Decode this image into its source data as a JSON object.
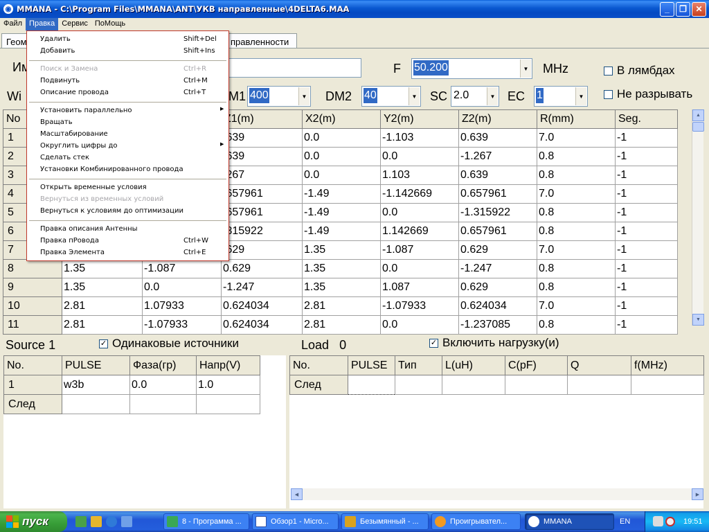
{
  "window": {
    "title": "MMANA - C:\\Program Files\\MMANA\\ANT\\УКВ направленные\\4DELTA6.MAA",
    "minimize": "_",
    "maximize": "❐",
    "close": "✕"
  },
  "menubar": [
    "Файл",
    "Правка",
    "Сервис",
    "ПоМощь"
  ],
  "tabs": [
    "Геом",
    "правленности"
  ],
  "params": {
    "name_label": "Им",
    "name_value": "",
    "f_label": "F",
    "f_value": "50.200",
    "mhz_label": "MHz",
    "lambda_label": "В лямбдах",
    "nobreak_label": "Не разрывать",
    "wire_label": "Wi",
    "dm1_label": "M1",
    "dm1_value": "400",
    "dm2_label": "DM2",
    "dm2_value": "40",
    "sc_label": "SC",
    "sc_value": "2.0",
    "ec_label": "EC",
    "ec_value": "1"
  },
  "wire_table": {
    "headers": [
      "No",
      "",
      "",
      "Z1(m)",
      "X2(m)",
      "Y2(m)",
      "Z2(m)",
      "R(mm)",
      "Seg."
    ],
    "rows": [
      [
        "1",
        "",
        "",
        ".639",
        "0.0",
        "-1.103",
        "0.639",
        "7.0",
        "-1"
      ],
      [
        "2",
        "",
        "",
        ".639",
        "0.0",
        "0.0",
        "-1.267",
        "0.8",
        "-1"
      ],
      [
        "3",
        "",
        "",
        ".267",
        "0.0",
        "1.103",
        "0.639",
        "0.8",
        "-1"
      ],
      [
        "4",
        "",
        "",
        ".657961",
        "-1.49",
        "-1.142669",
        "0.657961",
        "7.0",
        "-1"
      ],
      [
        "5",
        "",
        "",
        ".657961",
        "-1.49",
        "0.0",
        "-1.315922",
        "0.8",
        "-1"
      ],
      [
        "6",
        "",
        "",
        ".315922",
        "-1.49",
        "1.142669",
        "0.657961",
        "0.8",
        "-1"
      ],
      [
        "7",
        "",
        "",
        ".629",
        "1.35",
        "-1.087",
        "0.629",
        "7.0",
        "-1"
      ],
      [
        "8",
        "1.35",
        "-1.087",
        "0.629",
        "1.35",
        "0.0",
        "-1.247",
        "0.8",
        "-1"
      ],
      [
        "9",
        "1.35",
        "0.0",
        "-1.247",
        "1.35",
        "1.087",
        "0.629",
        "0.8",
        "-1"
      ],
      [
        "10",
        "2.81",
        "1.07933",
        "0.624034",
        "2.81",
        "-1.07933",
        "0.624034",
        "7.0",
        "-1"
      ],
      [
        "11",
        "2.81",
        "-1.07933",
        "0.624034",
        "2.81",
        "0.0",
        "-1.237085",
        "0.8",
        "-1"
      ]
    ]
  },
  "source": {
    "label": "Source",
    "count": "1",
    "same_label": "Одинаковые источники",
    "headers": [
      "No.",
      "PULSE",
      "Фаза(гр)",
      "Напр(V)"
    ],
    "rows": [
      [
        "1",
        "w3b",
        "0.0",
        "1.0"
      ],
      [
        "След",
        "",
        "",
        ""
      ]
    ]
  },
  "load": {
    "label": "Load",
    "count": "0",
    "enable_label": "Включить нагрузку(и)",
    "headers": [
      "No.",
      "PULSE",
      "Тип",
      "L(uH)",
      "C(pF)",
      "Q",
      "f(MHz)"
    ],
    "rows": [
      [
        "След",
        "",
        "",
        "",
        "",
        "",
        ""
      ]
    ]
  },
  "edit_menu": {
    "items": [
      {
        "label": "Удалить",
        "shortcut": "Shift+Del"
      },
      {
        "label": "Добавить",
        "shortcut": "Shift+Ins"
      },
      {
        "label": "Поиск и Замена",
        "shortcut": "Ctrl+R"
      },
      {
        "label": "Подвинуть",
        "shortcut": "Ctrl+M"
      },
      {
        "label": "Описание провода",
        "shortcut": "Ctrl+T"
      },
      {
        "label": "Установить параллельно",
        "shortcut": ""
      },
      {
        "label": "Вращать",
        "shortcut": ""
      },
      {
        "label": "Масштабирование",
        "shortcut": ""
      },
      {
        "label": "Округлить цифры до",
        "shortcut": ""
      },
      {
        "label": "Сделать стек",
        "shortcut": ""
      },
      {
        "label": "Установки Комбинированного провода",
        "shortcut": ""
      },
      {
        "label": "Открыть временные условия",
        "shortcut": ""
      },
      {
        "label": "Вернуться из временных условий",
        "shortcut": ""
      },
      {
        "label": "Вернуться к условиям до оптимизации",
        "shortcut": ""
      },
      {
        "label": "Правка описания Антенны",
        "shortcut": ""
      },
      {
        "label": "Правка пРовода",
        "shortcut": "Ctrl+W"
      },
      {
        "label": "Правка Элемента",
        "shortcut": "Ctrl+E"
      }
    ],
    "submenu_arrow": "▶"
  },
  "taskbar": {
    "start": "пуск",
    "tasks": [
      "8 - Программа ...",
      "Обзор1 - Micro...",
      "Безымянный - ...",
      "Проигрывател...",
      "MMANA"
    ],
    "lang": "EN",
    "clock": "19:51"
  }
}
